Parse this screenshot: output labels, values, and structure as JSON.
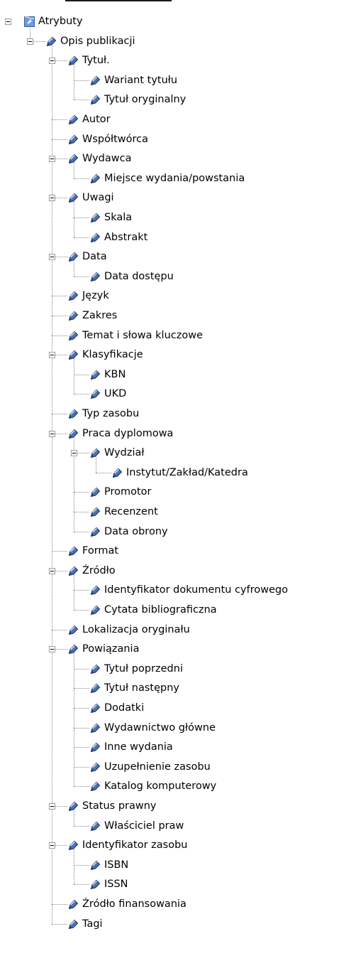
{
  "tree": {
    "root": {
      "label": "Atrybuty",
      "children": [
        {
          "label": "Opis publikacji",
          "children": [
            {
              "label": "Tytuł.",
              "children": [
                {
                  "label": "Wariant tytułu"
                },
                {
                  "label": "Tytuł oryginalny"
                }
              ]
            },
            {
              "label": "Autor"
            },
            {
              "label": "Współtwórca"
            },
            {
              "label": "Wydawca",
              "children": [
                {
                  "label": "Miejsce wydania/powstania"
                }
              ]
            },
            {
              "label": "Uwagi",
              "children": [
                {
                  "label": "Skala"
                },
                {
                  "label": "Abstrakt"
                }
              ]
            },
            {
              "label": "Data",
              "children": [
                {
                  "label": "Data dostępu"
                }
              ]
            },
            {
              "label": "Język"
            },
            {
              "label": "Zakres"
            },
            {
              "label": "Temat i słowa kluczowe"
            },
            {
              "label": "Klasyfikacje",
              "children": [
                {
                  "label": "KBN"
                },
                {
                  "label": "UKD"
                }
              ]
            },
            {
              "label": "Typ zasobu"
            },
            {
              "label": "Praca dyplomowa",
              "children": [
                {
                  "label": "Wydział",
                  "children": [
                    {
                      "label": "Instytut/Zakład/Katedra"
                    }
                  ]
                },
                {
                  "label": "Promotor"
                },
                {
                  "label": "Recenzent"
                },
                {
                  "label": "Data obrony"
                }
              ]
            },
            {
              "label": "Format"
            },
            {
              "label": "Źródło",
              "children": [
                {
                  "label": "Identyfikator dokumentu cyfrowego"
                },
                {
                  "label": "Cytata bibliograficzna"
                }
              ]
            },
            {
              "label": "Lokalizacja oryginału"
            },
            {
              "label": "Powiązania",
              "children": [
                {
                  "label": "Tytuł poprzedni"
                },
                {
                  "label": "Tytuł następny"
                },
                {
                  "label": "Dodatki"
                },
                {
                  "label": "Wydawnictwo główne"
                },
                {
                  "label": "Inne wydania"
                },
                {
                  "label": "Uzupełnienie zasobu"
                },
                {
                  "label": "Katalog komputerowy"
                }
              ]
            },
            {
              "label": "Status prawny",
              "children": [
                {
                  "label": "Właściciel praw"
                }
              ]
            },
            {
              "label": "Identyfikator zasobu",
              "children": [
                {
                  "label": "ISBN"
                },
                {
                  "label": "ISSN"
                }
              ]
            },
            {
              "label": "Źródło finansowania"
            },
            {
              "label": "Tagi"
            }
          ]
        }
      ]
    }
  },
  "colors": {
    "node_icon_fill": "#4a74b8",
    "node_icon_highlight": "#cfe0fa",
    "root_icon_fill": "#6b9be0",
    "dotted_line": "#8a8a8a",
    "toggle_border": "#9a9a9a"
  }
}
